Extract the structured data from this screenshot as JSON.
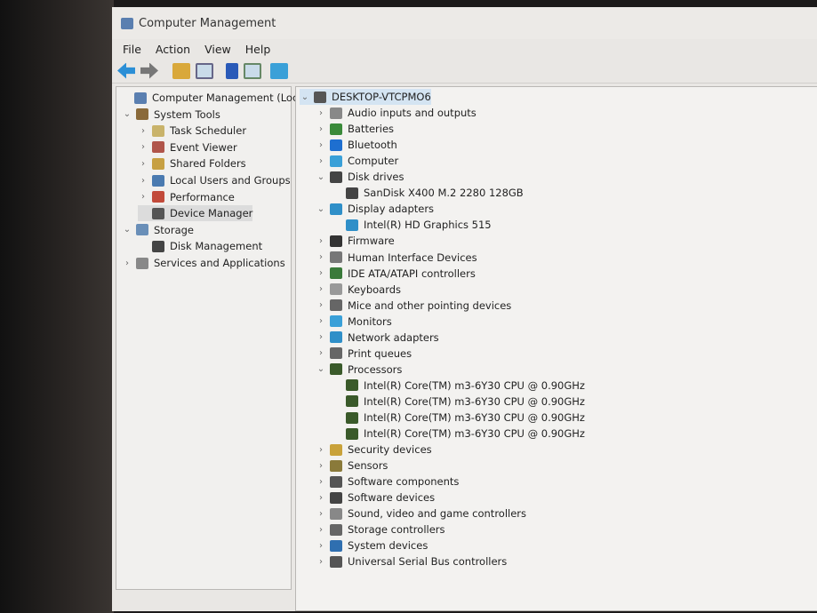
{
  "window": {
    "title": "Computer Management"
  },
  "menu": [
    "File",
    "Action",
    "View",
    "Help"
  ],
  "toolbar": [
    "back-icon",
    "forward-icon",
    "folder-up-icon",
    "show-hide-tree-icon",
    "help-icon",
    "show-action-pane-icon",
    "monitor-icon"
  ],
  "left_tree": [
    {
      "label": "Computer Management (Local)",
      "level": 0,
      "chev": "",
      "icon": "#5a7fb0"
    },
    {
      "label": "System Tools",
      "level": 1,
      "chev": "⌄",
      "icon": "#8a6a3a"
    },
    {
      "label": "Task Scheduler",
      "level": 2,
      "chev": "›",
      "icon": "#c9b36a"
    },
    {
      "label": "Event Viewer",
      "level": 2,
      "chev": "›",
      "icon": "#b0554a"
    },
    {
      "label": "Shared Folders",
      "level": 2,
      "chev": "›",
      "icon": "#c7a043"
    },
    {
      "label": "Local Users and Groups",
      "level": 2,
      "chev": "›",
      "icon": "#4a7ab0"
    },
    {
      "label": "Performance",
      "level": 2,
      "chev": "›",
      "icon": "#c24a3a"
    },
    {
      "label": "Device Manager",
      "level": 2,
      "chev": "",
      "icon": "#555",
      "selected": true
    },
    {
      "label": "Storage",
      "level": 1,
      "chev": "⌄",
      "icon": "#6a8fb8"
    },
    {
      "label": "Disk Management",
      "level": 2,
      "chev": "",
      "icon": "#444"
    },
    {
      "label": "Services and Applications",
      "level": 1,
      "chev": "›",
      "icon": "#888"
    }
  ],
  "device_tree": [
    {
      "label": "DESKTOP-VTCPMO6",
      "level": 0,
      "chev": "⌄",
      "icon": "#555",
      "highlight": true
    },
    {
      "label": "Audio inputs and outputs",
      "level": 1,
      "chev": "›",
      "icon": "#888"
    },
    {
      "label": "Batteries",
      "level": 1,
      "chev": "›",
      "icon": "#3a8a3a"
    },
    {
      "label": "Bluetooth",
      "level": 1,
      "chev": "›",
      "icon": "#1e6fd0"
    },
    {
      "label": "Computer",
      "level": 1,
      "chev": "›",
      "icon": "#3aa0d8"
    },
    {
      "label": "Disk drives",
      "level": 1,
      "chev": "⌄",
      "icon": "#444"
    },
    {
      "label": "SanDisk X400 M.2 2280 128GB",
      "level": 2,
      "chev": "",
      "icon": "#444"
    },
    {
      "label": "Display adapters",
      "level": 1,
      "chev": "⌄",
      "icon": "#2f8fc8"
    },
    {
      "label": "Intel(R) HD Graphics 515",
      "level": 2,
      "chev": "",
      "icon": "#2f8fc8"
    },
    {
      "label": "Firmware",
      "level": 1,
      "chev": "›",
      "icon": "#333"
    },
    {
      "label": "Human Interface Devices",
      "level": 1,
      "chev": "›",
      "icon": "#777"
    },
    {
      "label": "IDE ATA/ATAPI controllers",
      "level": 1,
      "chev": "›",
      "icon": "#3a7a3a"
    },
    {
      "label": "Keyboards",
      "level": 1,
      "chev": "›",
      "icon": "#999"
    },
    {
      "label": "Mice and other pointing devices",
      "level": 1,
      "chev": "›",
      "icon": "#666"
    },
    {
      "label": "Monitors",
      "level": 1,
      "chev": "›",
      "icon": "#3aa0d8"
    },
    {
      "label": "Network adapters",
      "level": 1,
      "chev": "›",
      "icon": "#2f8fc8"
    },
    {
      "label": "Print queues",
      "level": 1,
      "chev": "›",
      "icon": "#666"
    },
    {
      "label": "Processors",
      "level": 1,
      "chev": "⌄",
      "icon": "#3a5a2a"
    },
    {
      "label": "Intel(R) Core(TM) m3-6Y30 CPU @ 0.90GHz",
      "level": 2,
      "chev": "",
      "icon": "#3a5a2a"
    },
    {
      "label": "Intel(R) Core(TM) m3-6Y30 CPU @ 0.90GHz",
      "level": 2,
      "chev": "",
      "icon": "#3a5a2a"
    },
    {
      "label": "Intel(R) Core(TM) m3-6Y30 CPU @ 0.90GHz",
      "level": 2,
      "chev": "",
      "icon": "#3a5a2a"
    },
    {
      "label": "Intel(R) Core(TM) m3-6Y30 CPU @ 0.90GHz",
      "level": 2,
      "chev": "",
      "icon": "#3a5a2a"
    },
    {
      "label": "Security devices",
      "level": 1,
      "chev": "›",
      "icon": "#c9a23a"
    },
    {
      "label": "Sensors",
      "level": 1,
      "chev": "›",
      "icon": "#8a7a3a"
    },
    {
      "label": "Software components",
      "level": 1,
      "chev": "›",
      "icon": "#555"
    },
    {
      "label": "Software devices",
      "level": 1,
      "chev": "›",
      "icon": "#444"
    },
    {
      "label": "Sound, video and game controllers",
      "level": 1,
      "chev": "›",
      "icon": "#888"
    },
    {
      "label": "Storage controllers",
      "level": 1,
      "chev": "›",
      "icon": "#666"
    },
    {
      "label": "System devices",
      "level": 1,
      "chev": "›",
      "icon": "#2f6fb0"
    },
    {
      "label": "Universal Serial Bus controllers",
      "level": 1,
      "chev": "›",
      "icon": "#555"
    }
  ]
}
